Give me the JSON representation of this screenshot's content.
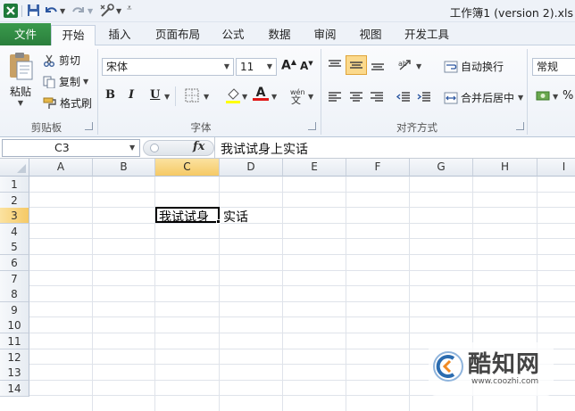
{
  "title_bar": {
    "title": "工作簿1 (version 2).xls"
  },
  "tabs": [
    "文件",
    "开始",
    "插入",
    "页面布局",
    "公式",
    "数据",
    "审阅",
    "视图",
    "开发工具"
  ],
  "active_tab": "开始",
  "ribbon": {
    "clipboard": {
      "label": "剪贴板",
      "paste": "粘贴",
      "cut": "剪切",
      "copy": "复制",
      "format_painter": "格式刷"
    },
    "font": {
      "label": "字体",
      "font_name": "宋体",
      "font_size": "11",
      "bold": "B",
      "italic": "I",
      "underline": "U"
    },
    "alignment": {
      "label": "对齐方式",
      "wrap_text": "自动换行",
      "merge_center": "合并后居中"
    },
    "number": {
      "format": "常规"
    }
  },
  "formula_bar": {
    "name_box": "C3",
    "fx": "fx",
    "formula": "我试试身上实话"
  },
  "columns": [
    "A",
    "B",
    "C",
    "D",
    "E",
    "F",
    "G",
    "H",
    "I"
  ],
  "rows": [
    "1",
    "2",
    "3",
    "4",
    "5",
    "6",
    "7",
    "8",
    "9",
    "10",
    "11",
    "12",
    "13",
    "14"
  ],
  "active_cell": "C3",
  "cells": {
    "C3_visible": "我试试身",
    "D3_overflow": "实话"
  },
  "watermark": {
    "brand": "酷知网",
    "url": "www.coozhi.com"
  },
  "colors": {
    "file_tab": "#2a8a40",
    "selected_header": "#f5c965",
    "grid_line": "#d9dee6"
  }
}
